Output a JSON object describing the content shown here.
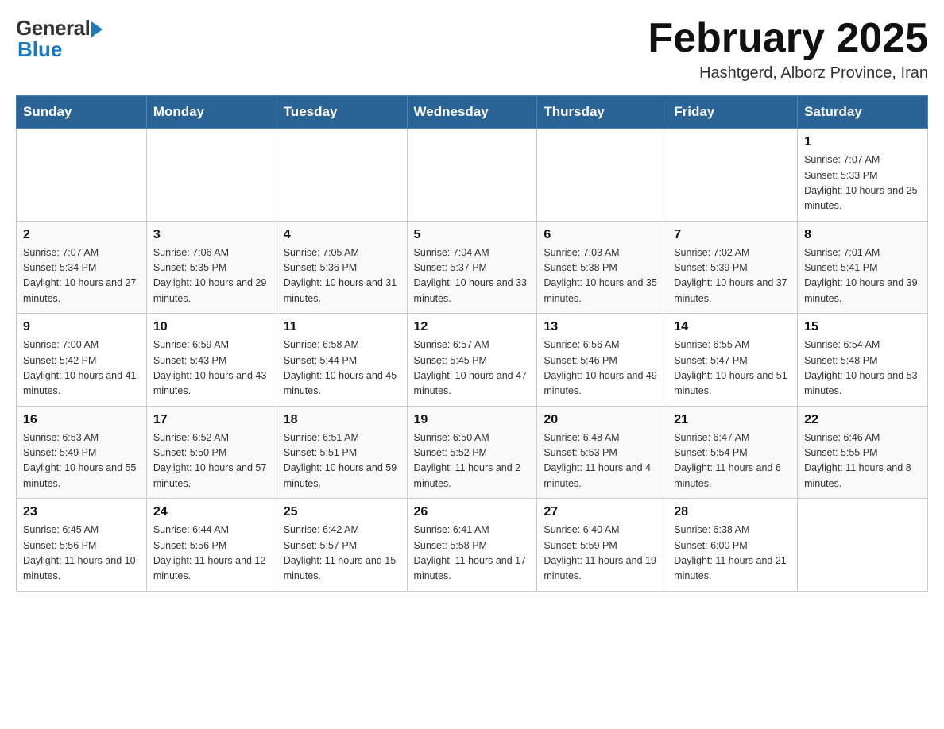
{
  "logo": {
    "general": "General",
    "blue": "Blue"
  },
  "title": "February 2025",
  "subtitle": "Hashtgerd, Alborz Province, Iran",
  "headers": [
    "Sunday",
    "Monday",
    "Tuesday",
    "Wednesday",
    "Thursday",
    "Friday",
    "Saturday"
  ],
  "weeks": [
    [
      {
        "day": "",
        "info": ""
      },
      {
        "day": "",
        "info": ""
      },
      {
        "day": "",
        "info": ""
      },
      {
        "day": "",
        "info": ""
      },
      {
        "day": "",
        "info": ""
      },
      {
        "day": "",
        "info": ""
      },
      {
        "day": "1",
        "info": "Sunrise: 7:07 AM\nSunset: 5:33 PM\nDaylight: 10 hours and 25 minutes."
      }
    ],
    [
      {
        "day": "2",
        "info": "Sunrise: 7:07 AM\nSunset: 5:34 PM\nDaylight: 10 hours and 27 minutes."
      },
      {
        "day": "3",
        "info": "Sunrise: 7:06 AM\nSunset: 5:35 PM\nDaylight: 10 hours and 29 minutes."
      },
      {
        "day": "4",
        "info": "Sunrise: 7:05 AM\nSunset: 5:36 PM\nDaylight: 10 hours and 31 minutes."
      },
      {
        "day": "5",
        "info": "Sunrise: 7:04 AM\nSunset: 5:37 PM\nDaylight: 10 hours and 33 minutes."
      },
      {
        "day": "6",
        "info": "Sunrise: 7:03 AM\nSunset: 5:38 PM\nDaylight: 10 hours and 35 minutes."
      },
      {
        "day": "7",
        "info": "Sunrise: 7:02 AM\nSunset: 5:39 PM\nDaylight: 10 hours and 37 minutes."
      },
      {
        "day": "8",
        "info": "Sunrise: 7:01 AM\nSunset: 5:41 PM\nDaylight: 10 hours and 39 minutes."
      }
    ],
    [
      {
        "day": "9",
        "info": "Sunrise: 7:00 AM\nSunset: 5:42 PM\nDaylight: 10 hours and 41 minutes."
      },
      {
        "day": "10",
        "info": "Sunrise: 6:59 AM\nSunset: 5:43 PM\nDaylight: 10 hours and 43 minutes."
      },
      {
        "day": "11",
        "info": "Sunrise: 6:58 AM\nSunset: 5:44 PM\nDaylight: 10 hours and 45 minutes."
      },
      {
        "day": "12",
        "info": "Sunrise: 6:57 AM\nSunset: 5:45 PM\nDaylight: 10 hours and 47 minutes."
      },
      {
        "day": "13",
        "info": "Sunrise: 6:56 AM\nSunset: 5:46 PM\nDaylight: 10 hours and 49 minutes."
      },
      {
        "day": "14",
        "info": "Sunrise: 6:55 AM\nSunset: 5:47 PM\nDaylight: 10 hours and 51 minutes."
      },
      {
        "day": "15",
        "info": "Sunrise: 6:54 AM\nSunset: 5:48 PM\nDaylight: 10 hours and 53 minutes."
      }
    ],
    [
      {
        "day": "16",
        "info": "Sunrise: 6:53 AM\nSunset: 5:49 PM\nDaylight: 10 hours and 55 minutes."
      },
      {
        "day": "17",
        "info": "Sunrise: 6:52 AM\nSunset: 5:50 PM\nDaylight: 10 hours and 57 minutes."
      },
      {
        "day": "18",
        "info": "Sunrise: 6:51 AM\nSunset: 5:51 PM\nDaylight: 10 hours and 59 minutes."
      },
      {
        "day": "19",
        "info": "Sunrise: 6:50 AM\nSunset: 5:52 PM\nDaylight: 11 hours and 2 minutes."
      },
      {
        "day": "20",
        "info": "Sunrise: 6:48 AM\nSunset: 5:53 PM\nDaylight: 11 hours and 4 minutes."
      },
      {
        "day": "21",
        "info": "Sunrise: 6:47 AM\nSunset: 5:54 PM\nDaylight: 11 hours and 6 minutes."
      },
      {
        "day": "22",
        "info": "Sunrise: 6:46 AM\nSunset: 5:55 PM\nDaylight: 11 hours and 8 minutes."
      }
    ],
    [
      {
        "day": "23",
        "info": "Sunrise: 6:45 AM\nSunset: 5:56 PM\nDaylight: 11 hours and 10 minutes."
      },
      {
        "day": "24",
        "info": "Sunrise: 6:44 AM\nSunset: 5:56 PM\nDaylight: 11 hours and 12 minutes."
      },
      {
        "day": "25",
        "info": "Sunrise: 6:42 AM\nSunset: 5:57 PM\nDaylight: 11 hours and 15 minutes."
      },
      {
        "day": "26",
        "info": "Sunrise: 6:41 AM\nSunset: 5:58 PM\nDaylight: 11 hours and 17 minutes."
      },
      {
        "day": "27",
        "info": "Sunrise: 6:40 AM\nSunset: 5:59 PM\nDaylight: 11 hours and 19 minutes."
      },
      {
        "day": "28",
        "info": "Sunrise: 6:38 AM\nSunset: 6:00 PM\nDaylight: 11 hours and 21 minutes."
      },
      {
        "day": "",
        "info": ""
      }
    ]
  ]
}
